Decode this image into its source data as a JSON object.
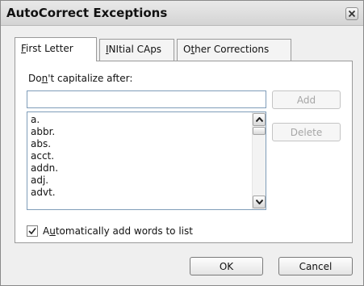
{
  "window": {
    "title": "AutoCorrect Exceptions"
  },
  "tabs": [
    {
      "pre": "",
      "key": "F",
      "post": "irst Letter",
      "active": true
    },
    {
      "pre": "",
      "key": "I",
      "post": "NItial CAps",
      "active": false
    },
    {
      "pre": "O",
      "key": "t",
      "post": "her Corrections",
      "active": false
    }
  ],
  "panel": {
    "label": {
      "pre": "Do",
      "key": "n",
      "post": "'t capitalize after:"
    },
    "input_value": "",
    "list_items": [
      "a.",
      "abbr.",
      "abs.",
      "acct.",
      "addn.",
      "adj.",
      "advt."
    ],
    "add_label": "Add",
    "delete_label": "Delete",
    "checkbox": {
      "pre": "A",
      "key": "u",
      "post": "tomatically add words to list",
      "checked": true
    }
  },
  "footer": {
    "ok_label": "OK",
    "cancel_label": "Cancel"
  },
  "icons": {
    "close": "close-icon",
    "scroll_up": "chevron-up-icon",
    "scroll_down": "chevron-down-icon",
    "check": "check-icon"
  }
}
